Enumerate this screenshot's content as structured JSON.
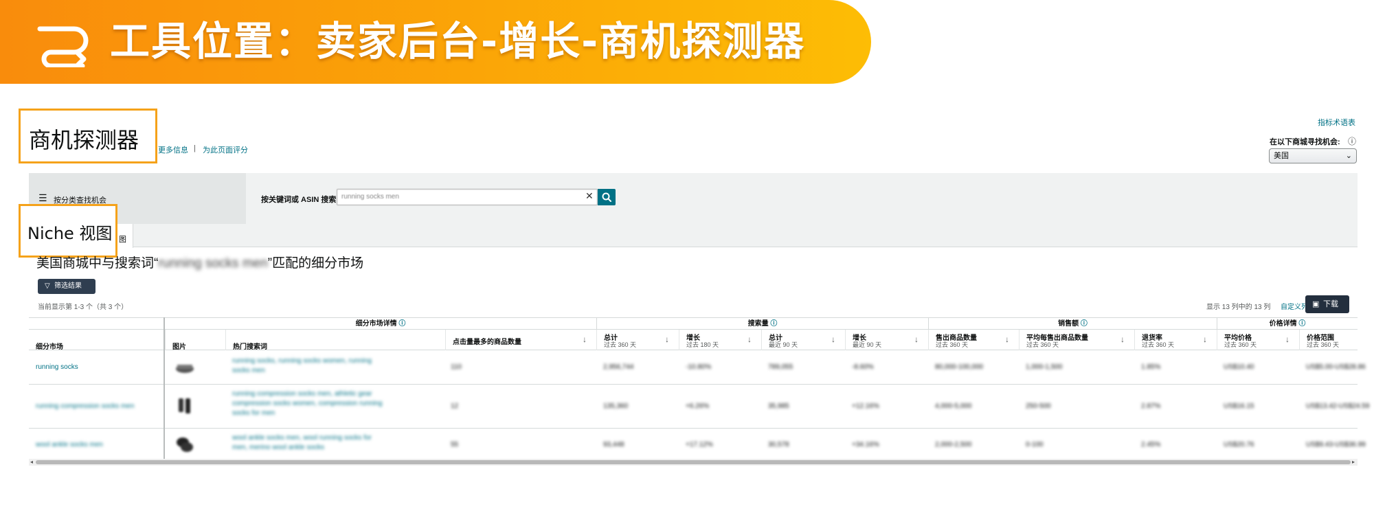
{
  "banner": {
    "title": "工具位置：卖家后台-增长-商机探测器",
    "colors": {
      "start": "#f98c0c",
      "end": "#fdbd05"
    },
    "icon": "route-icon"
  },
  "callouts": {
    "page_title": "商机探测器",
    "view_label": "Niche 视图"
  },
  "header": {
    "more_info_link": "更多信息",
    "separator": "|",
    "rate_link": "为此页面评分",
    "glossary_link": "指标术语表",
    "marketplace_label": "在以下商城寻找机会:",
    "marketplace_value": "美国"
  },
  "search": {
    "category_button": "按分类查找机会",
    "label": "按关键词或 ASIN 搜索",
    "query": "running socks men"
  },
  "tabs": {
    "active_suffix": "图"
  },
  "results": {
    "title_prefix": "美国商城中与搜索词“",
    "title_query": "running socks men",
    "title_suffix": "”匹配的细分市场",
    "filter_button": "筛选结果",
    "count_text": "当前显示第 1-3 个（共 3 个）",
    "columns_shown": "显示 13 列中的 13 列",
    "customize_link": "自定义列",
    "download_button": "下载"
  },
  "table": {
    "groups": {
      "niche_details": "细分市场详情",
      "search_volume": "搜索量",
      "sales": "销售额",
      "price": "价格详情"
    },
    "columns": {
      "niche": "细分市场",
      "image": "图片",
      "top_terms": "热门搜索词",
      "top_clicked": "点击量最多的商品数量",
      "sv_total": "总计",
      "sv_total_sub": "过去 360 天",
      "sv_growth": "增长",
      "sv_growth_sub": "过去 180 天",
      "sv_total90": "总计",
      "sv_total90_sub": "最近 90 天",
      "sv_growth90": "增长",
      "sv_growth90_sub": "最近 90 天",
      "units_sold": "售出商品数量",
      "units_sold_sub": "过去 360 天",
      "avg_units": "平均每售出商品数量",
      "avg_units_sub": "过去 360 天",
      "return_rate": "退货率",
      "return_rate_sub": "过去 360 天",
      "avg_price": "平均价格",
      "avg_price_sub": "过去 360 天",
      "price_range": "价格范围",
      "price_range_sub": "过去 360 天"
    },
    "rows": [
      {
        "niche": "running socks",
        "terms_line1": "running socks, running socks women, running",
        "terms_line2": "socks men",
        "top_clicked": "110",
        "sv_total": "2,956,744",
        "sv_growth": "-10.80%",
        "sv_total90": "789,055",
        "sv_growth90": "-8.60%",
        "units_sold": "80,000-100,000",
        "avg_units": "1,000-1,500",
        "return_rate": "1.85%",
        "avg_price": "US$10.40",
        "price_range": "US$5.00-US$28.86"
      },
      {
        "niche": "running compression socks men",
        "terms_line1": "running compression socks men, athletic gear",
        "terms_line2": "compression socks women, compression running",
        "terms_line3": "socks for men",
        "top_clicked": "12",
        "sv_total": "135,360",
        "sv_growth": "+6.26%",
        "sv_total90": "35,985",
        "sv_growth90": "+12.16%",
        "units_sold": "4,000-5,000",
        "avg_units": "250-500",
        "return_rate": "2.87%",
        "avg_price": "US$16.15",
        "price_range": "US$13.42-US$24.59"
      },
      {
        "niche": "wool ankle socks men",
        "terms_line1": "wool ankle socks men, wool running socks for",
        "terms_line2": "men, merino wool ankle socks",
        "top_clicked": "55",
        "sv_total": "93,448",
        "sv_growth": "+17.12%",
        "sv_total90": "30,578",
        "sv_growth90": "+34.16%",
        "units_sold": "2,000-2,500",
        "avg_units": "0-100",
        "return_rate": "2.45%",
        "avg_price": "US$20.76",
        "price_range": "US$9.43-US$36.99"
      }
    ]
  }
}
